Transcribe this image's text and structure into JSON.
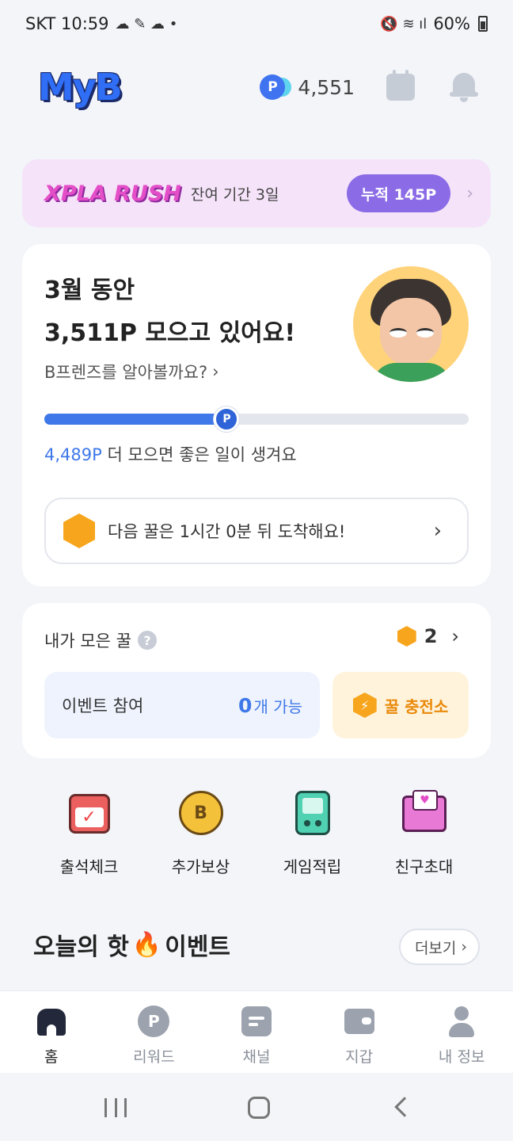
{
  "status_bar": {
    "carrier_time": "SKT 10:59",
    "battery": "60%"
  },
  "header": {
    "logo_text": "MyB",
    "point_balance": "4,551"
  },
  "rush_banner": {
    "title": "XPLA RUSH",
    "remaining": "잔여 기간 3일",
    "accumulated": "누적 145P"
  },
  "points_card": {
    "line1": "3월 동안",
    "line2": "3,511P 모으고 있어요!",
    "friends_link": "B프렌즈를 알아볼까요?",
    "progress_fraction": 0.43,
    "progress_knob": "P",
    "note_highlight": "4,489P",
    "note_rest": " 더 모으면 좋은 일이 생겨요",
    "next_honey": "다음 꿀은 1시간 0분 뒤 도착해요!"
  },
  "honey_card": {
    "title": "내가 모은 꿀",
    "count": "2",
    "event_label": "이벤트 참여",
    "event_count": "0",
    "event_unit": "개 가능",
    "charge_label": "꿀 충전소"
  },
  "shortcuts": [
    {
      "label": "출석체크",
      "icon": "calendar-check-icon"
    },
    {
      "label": "추가보상",
      "icon": "b-coin-icon"
    },
    {
      "label": "게임적립",
      "icon": "game-console-icon"
    },
    {
      "label": "친구초대",
      "icon": "invite-envelope-icon"
    }
  ],
  "today_section": {
    "title": "오늘의 핫",
    "title_suffix": " 이벤트",
    "more": "더보기"
  },
  "bottom_nav": [
    {
      "label": "홈",
      "active": true
    },
    {
      "label": "리워드",
      "active": false
    },
    {
      "label": "채널",
      "active": false
    },
    {
      "label": "지갑",
      "active": false
    },
    {
      "label": "내 정보",
      "active": false
    }
  ],
  "colors": {
    "accent_blue": "#3f78e8",
    "honey_orange": "#f7a51c",
    "rush_pink": "#e44fc8",
    "rush_purple": "#8b6be6"
  }
}
